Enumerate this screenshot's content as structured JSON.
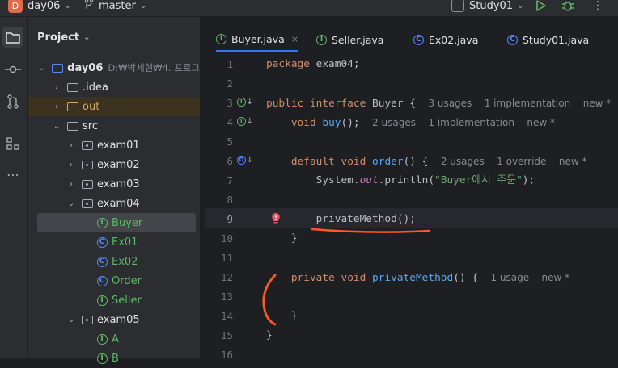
{
  "titlebar": {
    "project_badge": "D",
    "project_name": "day06",
    "branch_icon": "branch-icon",
    "branch": "master",
    "run_config": "Study01"
  },
  "sidebar": {
    "title": "Project",
    "tree": [
      {
        "label": "day06",
        "extra": "D:₩박세현₩4. 프로그",
        "type": "module",
        "expanded": true
      },
      {
        "label": ".idea",
        "type": "folder"
      },
      {
        "label": "out",
        "type": "folder-excluded"
      },
      {
        "label": "src",
        "type": "folder",
        "expanded": true
      },
      {
        "label": "exam01",
        "type": "package"
      },
      {
        "label": "exam02",
        "type": "package"
      },
      {
        "label": "exam03",
        "type": "package"
      },
      {
        "label": "exam04",
        "type": "package",
        "expanded": true
      },
      {
        "label": "Buyer",
        "type": "interface",
        "selected": true
      },
      {
        "label": "Ex01",
        "type": "class-run"
      },
      {
        "label": "Ex02",
        "type": "class-run"
      },
      {
        "label": "Order",
        "type": "class"
      },
      {
        "label": "Seller",
        "type": "interface"
      },
      {
        "label": "exam05",
        "type": "package",
        "expanded": true
      },
      {
        "label": "A",
        "type": "interface"
      },
      {
        "label": "B",
        "type": "interface"
      }
    ]
  },
  "tabs": [
    {
      "label": "Buyer.java",
      "icon": "interface-icon",
      "active": true,
      "close": "×"
    },
    {
      "label": "Seller.java",
      "icon": "interface-icon"
    },
    {
      "label": "Ex02.java",
      "icon": "run-class-icon"
    },
    {
      "label": "Study01.java",
      "icon": "class-icon"
    }
  ],
  "editor": {
    "line_numbers": [
      "1",
      "2",
      "3",
      "4",
      "5",
      "6",
      "7",
      "8",
      "9",
      "10",
      "11",
      "12",
      "13",
      "14",
      "15",
      "16"
    ],
    "current_line": "9",
    "lines": {
      "l1": {
        "kw": "package",
        "rest": " exam04;"
      },
      "l3": {
        "kw1": "public",
        "kw2": "interface",
        "name": "Buyer",
        "brace": " {",
        "hint1": "3 usages",
        "hint2": "1 implementation",
        "hint3": "new *"
      },
      "l4": {
        "kw": "void",
        "fn": "buy",
        "rest": "();",
        "hint1": "2 usages",
        "hint2": "1 implementation",
        "hint3": "new *"
      },
      "l6": {
        "kw1": "default",
        "kw2": "void",
        "fn": "order",
        "rest": "() {",
        "hint1": "2 usages",
        "hint2": "1 override",
        "hint3": "new *"
      },
      "l7": {
        "pre": "System.",
        "static": "out",
        "mid": ".println(",
        "str": "\"Buyer에서 주문\"",
        "post": ");"
      },
      "l9": {
        "fn": "privateMethod",
        "rest": "();"
      },
      "l10": {
        "text": "}"
      },
      "l12": {
        "kw1": "private",
        "kw2": "void",
        "fn": "privateMethod",
        "rest": "() {",
        "hint1": "1 usage",
        "hint2": "new *"
      },
      "l14": {
        "text": "}"
      },
      "l15": {
        "text": "}"
      }
    }
  },
  "colors": {
    "accent": "#3574f0",
    "annotation": "#ff5a1f",
    "error": "#e55765",
    "interface_green": "#5fb865",
    "class_blue": "#548af7"
  }
}
